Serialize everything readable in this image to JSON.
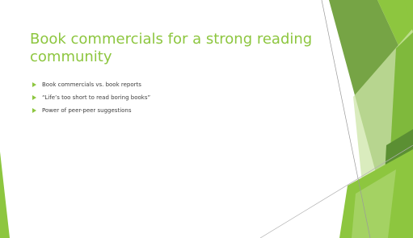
{
  "slide": {
    "title": "Book commercials for a strong reading community",
    "bullets": [
      "Book commercials vs. book reports",
      "“Life’s too short to read boring books”",
      "Power of peer-peer suggestions"
    ]
  },
  "icons": {
    "bullet": "triangle-right-icon"
  },
  "colors": {
    "accent": "#8dc63f",
    "dark_green": "#5b8f33",
    "text": "#404040",
    "background": "#ffffff"
  }
}
